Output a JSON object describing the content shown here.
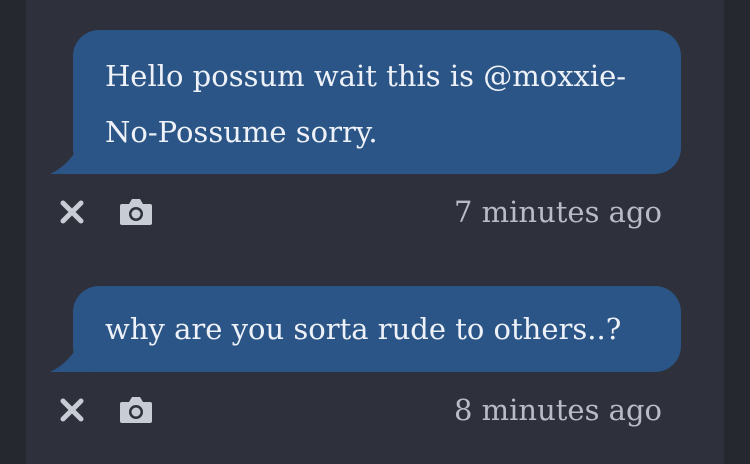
{
  "colors": {
    "background": "#262830",
    "panel": "#2e313b",
    "bubble": "#2b5586",
    "bubble_text": "#eef2f8",
    "meta_text": "#b8bcc6"
  },
  "messages": [
    {
      "text": "Hello possum wait this is @moxxie-No-Possume sorry.",
      "timestamp": "7 minutes ago",
      "actions": [
        "close-icon",
        "camera-icon"
      ]
    },
    {
      "text": "why are you sorta rude to others..?",
      "timestamp": "8 minutes ago",
      "actions": [
        "close-icon",
        "camera-icon"
      ]
    }
  ]
}
